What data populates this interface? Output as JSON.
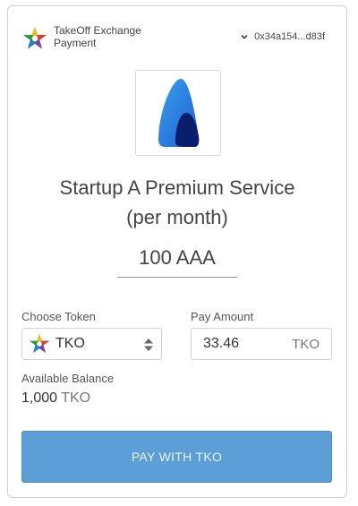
{
  "header": {
    "brand_line1": "TakeOff Exchange",
    "brand_line2": "Payment",
    "wallet_address": "0x34a154...d83f",
    "brand_icon": "star-logo-icon",
    "wallet_icon": "chevron-down-icon"
  },
  "product": {
    "logo_icon": "startup-a-logo",
    "title_line1": "Startup A Premium Service",
    "title_line2": "(per month)",
    "price": "100 AAA"
  },
  "form": {
    "choose_token_label": "Choose Token",
    "selected_token": "TKO",
    "pay_amount_label": "Pay Amount",
    "pay_amount_value": "33.46",
    "pay_amount_unit": "TKO",
    "available_balance_label": "Available Balance",
    "balance_value": "1,000",
    "balance_unit": "TKO"
  },
  "pay_button_label": "PAY WITH TKO",
  "colors": {
    "button_bg": "#5b9fd6",
    "logo_blue": "#1f6fd1",
    "logo_navy": "#0a1f6b"
  }
}
